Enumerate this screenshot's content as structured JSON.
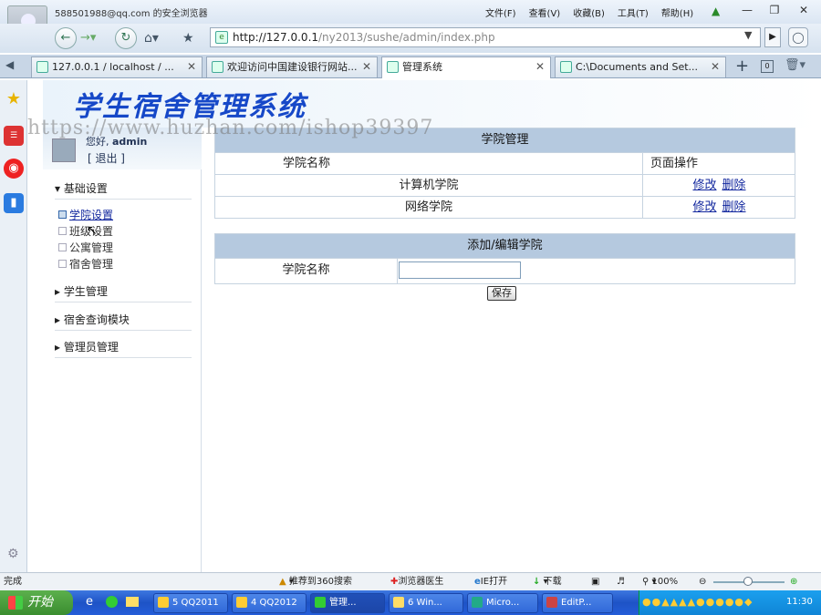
{
  "browser": {
    "account": "588501988@qq.com 的安全浏览器",
    "menus": [
      "文件(F)",
      "查看(V)",
      "收藏(B)",
      "工具(T)",
      "帮助(H)"
    ],
    "address_host": "http://127.0.0.1",
    "address_path": "/ny2013/sushe/admin/index.php",
    "tabs": [
      "127.0.0.1 / localhost / ...",
      "欢迎访问中国建设银行网站...",
      "管理系统",
      "C:\\Documents and Set..."
    ]
  },
  "page": {
    "system_title": "学生宿舍管理系统",
    "watermark": "https://www.huzhan.com/ishop39397",
    "user": {
      "greeting": "您好,",
      "name": "admin",
      "logout": "[ 退出 ]"
    },
    "nav": {
      "basic": {
        "label": "基础设置",
        "items": [
          "学院设置",
          "班级设置",
          "公寓管理",
          "宿舍管理"
        ]
      },
      "groups": [
        "学生管理",
        "宿舍查询模块",
        "管理员管理"
      ]
    },
    "list_table": {
      "title": "学院管理",
      "col_name": "学院名称",
      "col_ops": "页面操作",
      "rows": [
        {
          "name": "计算机学院",
          "edit": "修改",
          "del": "删除"
        },
        {
          "name": "网络学院",
          "edit": "修改",
          "del": "删除"
        }
      ]
    },
    "form": {
      "title": "添加/编辑学院",
      "field_label": "学院名称",
      "field_value": "",
      "save": "保存"
    }
  },
  "statusbar": {
    "left": "完成",
    "items": [
      "推荐到360搜索",
      "浏览器医生",
      "IE打开",
      "下载"
    ],
    "zoom": "100%"
  },
  "taskbar": {
    "start": "开始",
    "tasks": [
      "5 QQ2011",
      "4 QQ2012",
      "管理...",
      "6 Win...",
      "Micro...",
      "EditP..."
    ],
    "clock": "11:30"
  }
}
